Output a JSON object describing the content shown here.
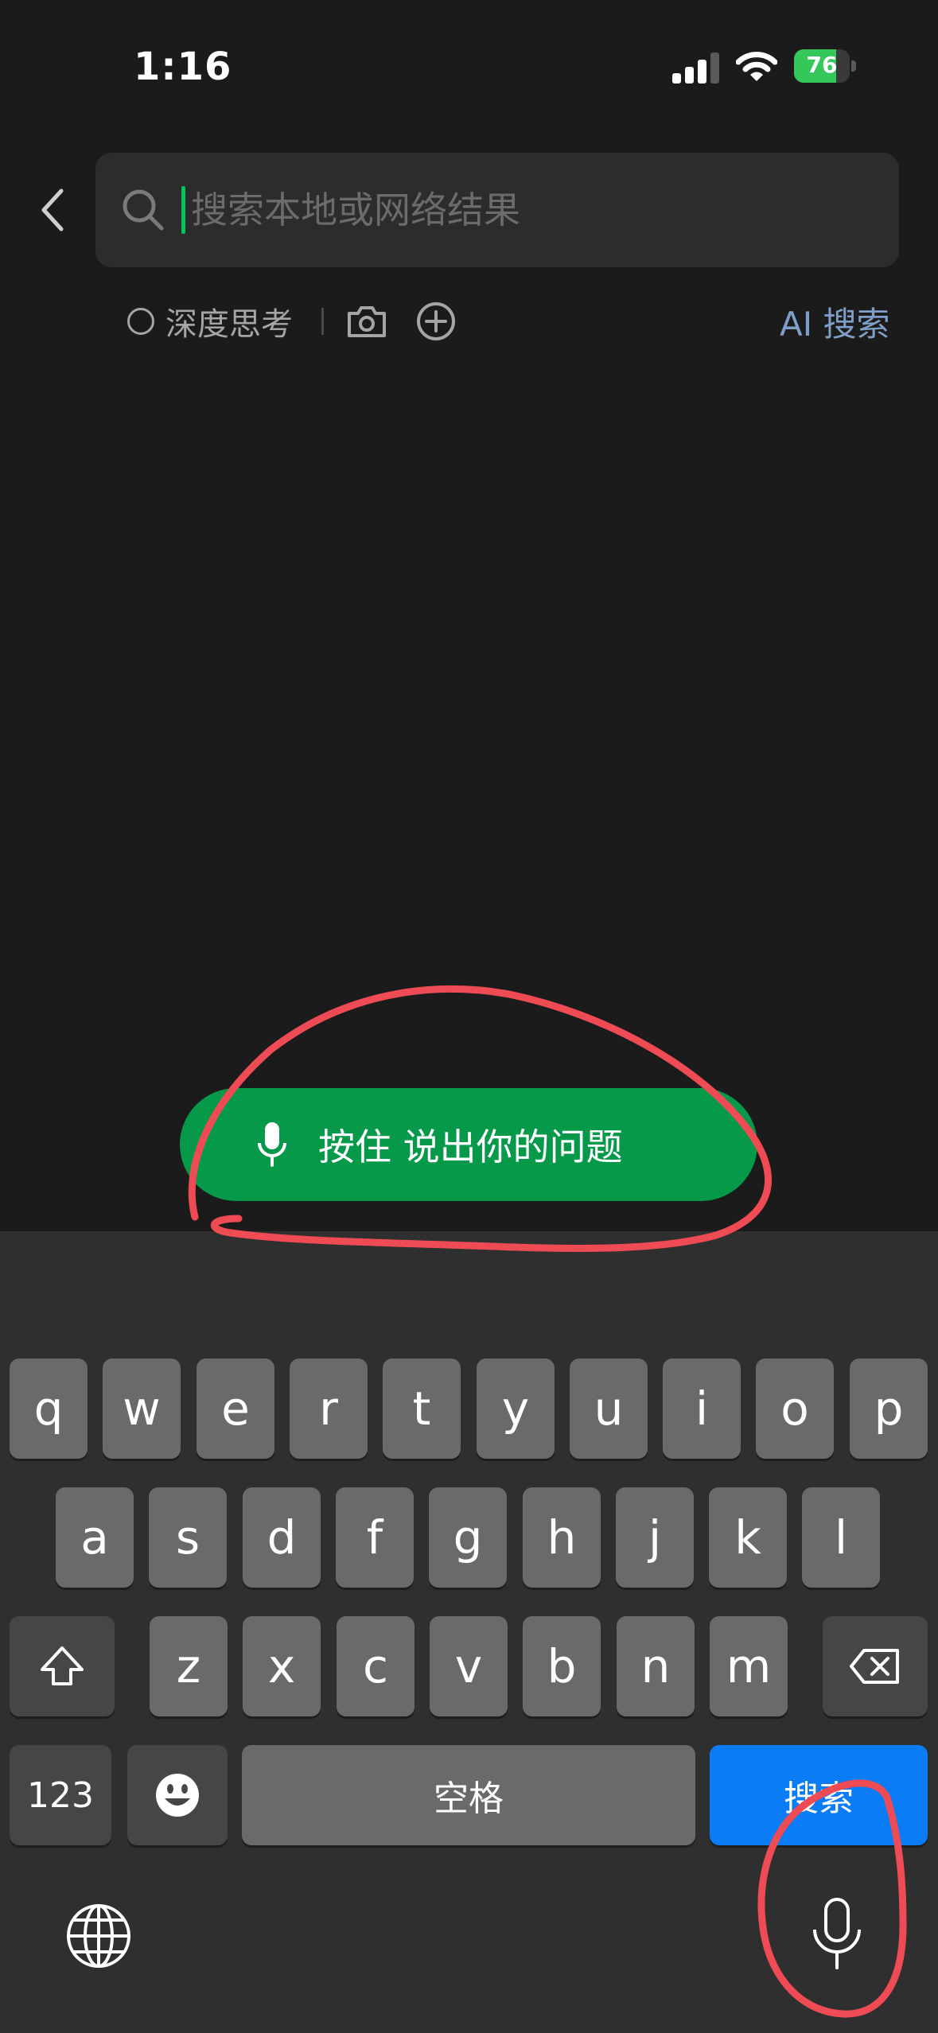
{
  "status_bar": {
    "time": "1:16",
    "battery": "76",
    "battery_level": 0.76
  },
  "search": {
    "placeholder": "搜索本地或网络结果",
    "value": ""
  },
  "tools": {
    "deep_think": "深度思考",
    "ai_search": "AI 搜索"
  },
  "voice": {
    "hold_to_talk": "按住 说出你的问题"
  },
  "keyboard": {
    "row1": [
      "q",
      "w",
      "e",
      "r",
      "t",
      "y",
      "u",
      "i",
      "o",
      "p"
    ],
    "row2": [
      "a",
      "s",
      "d",
      "f",
      "g",
      "h",
      "j",
      "k",
      "l"
    ],
    "row3": [
      "z",
      "x",
      "c",
      "v",
      "b",
      "n",
      "m"
    ],
    "numbers": "123",
    "space": "空格",
    "search": "搜索"
  },
  "colors": {
    "accent_green": "#07c160",
    "button_green": "#07994a",
    "key_blue": "#0a7cf5",
    "annotation_red": "#ef4b55"
  }
}
